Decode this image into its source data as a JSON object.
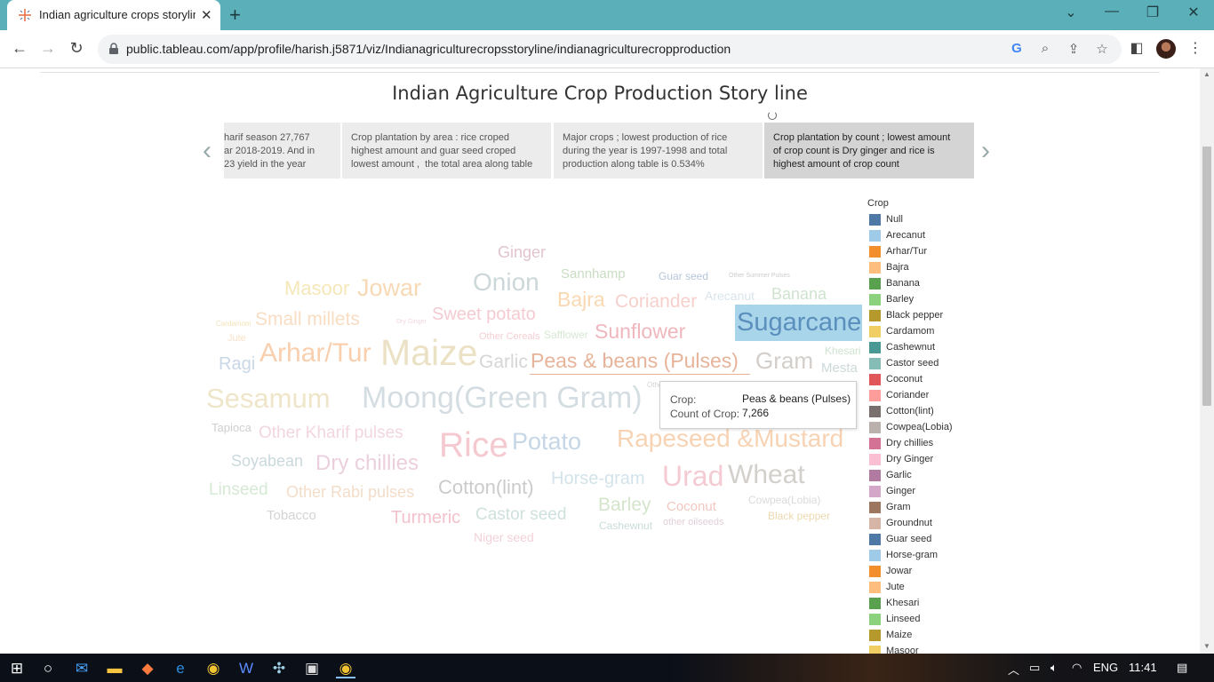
{
  "browser": {
    "tab_title": "Indian agriculture crops storyline",
    "new_tab": "+",
    "url": "public.tableau.com/app/profile/harish.j5871/viz/Indianagriculturecropsstoryline/indianagriculturecropproduction"
  },
  "story": {
    "title": "Indian Agriculture Crop Production Story line",
    "points": [
      "harif season 27,767\nar 2018-2019. And in\n23 yield in the year",
      "Crop plantation by area : rice croped\nhighest amount and guar seed croped\nlowest amount ,  the total area along table",
      "Major crops ; lowest production of rice\nduring the year is 1997-1998 and total\nproduction along table is 0.534%",
      "Crop plantation by count ; lowest amount\nof crop count is Dry ginger and rice is\nhighest amount of crop count"
    ]
  },
  "word_cloud": [
    {
      "text": "Ginger",
      "color": "#e2c4cf"
    },
    {
      "text": "Sannhamp",
      "color": "#c9ddc2"
    },
    {
      "text": "Guar seed",
      "color": "#b6c6d9"
    },
    {
      "text": "Other Summer Pulses",
      "color": "#cccccc"
    },
    {
      "text": "Masoor",
      "color": "#f5e7b8"
    },
    {
      "text": "Jowar",
      "color": "#f7d9b5"
    },
    {
      "text": "Onion",
      "color": "#ccd7d9"
    },
    {
      "text": "Bajra",
      "color": "#f9d8b2"
    },
    {
      "text": "Coriander",
      "color": "#f6d0cc"
    },
    {
      "text": "Arecanut",
      "color": "#d9e4ec"
    },
    {
      "text": "Banana",
      "color": "#cfe3cf"
    },
    {
      "text": "Cardamom",
      "color": "#f3e3b6"
    },
    {
      "text": "Small millets",
      "color": "#f8ddc3"
    },
    {
      "text": "Dry Ginger",
      "color": "#f2d6df"
    },
    {
      "text": "Sweet potato",
      "color": "#f4cbd2"
    },
    {
      "text": "Sugarcane",
      "color": "#5b8fbd"
    },
    {
      "text": "Jute",
      "color": "#f8e2c9"
    },
    {
      "text": "Other Cereals",
      "color": "#f3cfd3"
    },
    {
      "text": "Safflower",
      "color": "#d6e8d3"
    },
    {
      "text": "Sunflower",
      "color": "#f0b6bd"
    },
    {
      "text": "Khesari",
      "color": "#cfe3cf"
    },
    {
      "text": "Ragi",
      "color": "#c9d7e6"
    },
    {
      "text": "Arhar/Tur",
      "color": "#f9cfae"
    },
    {
      "text": "Maize",
      "color": "#ebe1c4"
    },
    {
      "text": "Garlic",
      "color": "#d5d5d5"
    },
    {
      "text": "Peas & beans (Pulses)",
      "color": "#e7b49a"
    },
    {
      "text": "Gram",
      "color": "#d3cec9"
    },
    {
      "text": "Mesta",
      "color": "#cbdad9"
    },
    {
      "text": "Sesamum",
      "color": "#efe5c9"
    },
    {
      "text": "Moong(Green Gram)",
      "color": "#d4dde2"
    },
    {
      "text": "Other",
      "color": "#d4d4d4"
    },
    {
      "text": "Tapioca",
      "color": "#cfcfcf"
    },
    {
      "text": "Other Kharif pulses",
      "color": "#f2d6df"
    },
    {
      "text": "Rice",
      "color": "#f4c9cf"
    },
    {
      "text": "Potato",
      "color": "#c5d6e6"
    },
    {
      "text": "Rapeseed &Mustard",
      "color": "#f8d3b3"
    },
    {
      "text": "Soyabean",
      "color": "#cad9dd"
    },
    {
      "text": "Dry chillies",
      "color": "#eccfdd"
    },
    {
      "text": "Linseed",
      "color": "#d6e9d4"
    },
    {
      "text": "Other Rabi pulses",
      "color": "#f3ddc9"
    },
    {
      "text": "Cotton(lint)",
      "color": "#cbcbcb"
    },
    {
      "text": "Horse-gram",
      "color": "#d3e3ea"
    },
    {
      "text": "Urad",
      "color": "#f4cbd2"
    },
    {
      "text": "Wheat",
      "color": "#d3d0cc"
    },
    {
      "text": "Tobacco",
      "color": "#d4d4d4"
    },
    {
      "text": "Turmeric",
      "color": "#f2c2cc"
    },
    {
      "text": "Castor seed",
      "color": "#cfe1dd"
    },
    {
      "text": "Barley",
      "color": "#d4e5cc"
    },
    {
      "text": "Coconut",
      "color": "#f2c8c0"
    },
    {
      "text": "Cowpea(Lobia)",
      "color": "#dadada"
    },
    {
      "text": "Black pepper",
      "color": "#ecd9b0"
    },
    {
      "text": "Cashewnut",
      "color": "#c9dcda"
    },
    {
      "text": "other oilseeds",
      "color": "#e3cfd9"
    },
    {
      "text": "Niger seed",
      "color": "#f4d1d8"
    }
  ],
  "tooltip": {
    "crop_label": "Crop:",
    "crop_value": "Peas & beans (Pulses)",
    "count_label": "Count of Crop:",
    "count_value": "7,266"
  },
  "legend": {
    "title": "Crop",
    "items": [
      {
        "label": "Null",
        "color": "#4e79a7"
      },
      {
        "label": "Arecanut",
        "color": "#a0cbe8"
      },
      {
        "label": "Arhar/Tur",
        "color": "#f28e2b"
      },
      {
        "label": "Bajra",
        "color": "#ffbe7d"
      },
      {
        "label": "Banana",
        "color": "#59a14f"
      },
      {
        "label": "Barley",
        "color": "#8cd17d"
      },
      {
        "label": "Black pepper",
        "color": "#b6992d"
      },
      {
        "label": "Cardamom",
        "color": "#f1ce63"
      },
      {
        "label": "Cashewnut",
        "color": "#499894"
      },
      {
        "label": "Castor seed",
        "color": "#86bcb6"
      },
      {
        "label": "Coconut",
        "color": "#e15759"
      },
      {
        "label": "Coriander",
        "color": "#ff9d9a"
      },
      {
        "label": "Cotton(lint)",
        "color": "#79706e"
      },
      {
        "label": "Cowpea(Lobia)",
        "color": "#bab0ac"
      },
      {
        "label": "Dry chillies",
        "color": "#d37295"
      },
      {
        "label": "Dry Ginger",
        "color": "#fabfd2"
      },
      {
        "label": "Garlic",
        "color": "#b07aa1"
      },
      {
        "label": "Ginger",
        "color": "#d4a6c8"
      },
      {
        "label": "Gram",
        "color": "#9d7660"
      },
      {
        "label": "Groundnut",
        "color": "#d7b5a6"
      },
      {
        "label": "Guar seed",
        "color": "#4e79a7"
      },
      {
        "label": "Horse-gram",
        "color": "#a0cbe8"
      },
      {
        "label": "Jowar",
        "color": "#f28e2b"
      },
      {
        "label": "Jute",
        "color": "#ffbe7d"
      },
      {
        "label": "Khesari",
        "color": "#59a14f"
      },
      {
        "label": "Linseed",
        "color": "#8cd17d"
      },
      {
        "label": "Maize",
        "color": "#b6992d"
      },
      {
        "label": "Masoor",
        "color": "#f1ce63"
      }
    ]
  },
  "taskbar": {
    "language": "ENG",
    "time": "11:41"
  }
}
